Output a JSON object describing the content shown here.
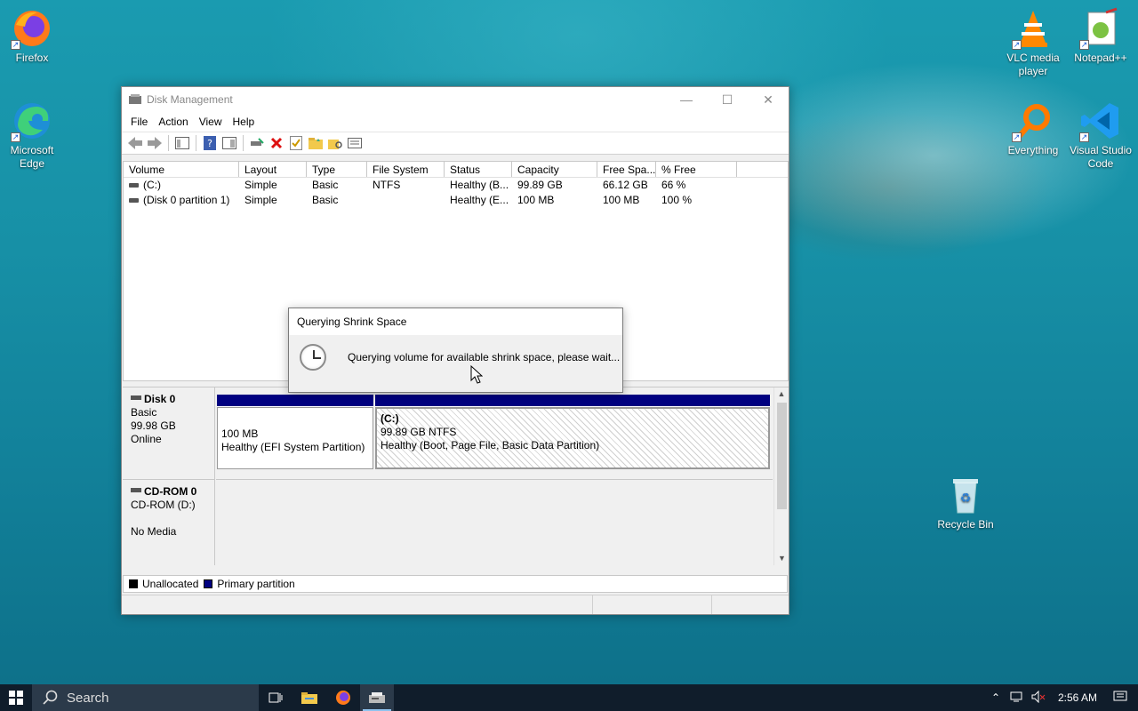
{
  "desktop": {
    "icons": {
      "firefox": "Firefox",
      "edge": "Microsoft Edge",
      "vlc": "VLC media player",
      "notepadpp": "Notepad++",
      "everything": "Everything",
      "vscode": "Visual Studio Code",
      "recycle_bin": "Recycle Bin"
    }
  },
  "window": {
    "title": "Disk Management",
    "menu": [
      "File",
      "Action",
      "View",
      "Help"
    ],
    "columns": [
      "Volume",
      "Layout",
      "Type",
      "File System",
      "Status",
      "Capacity",
      "Free Spa...",
      "% Free"
    ],
    "volumes": [
      {
        "volume": "(C:)",
        "layout": "Simple",
        "type": "Basic",
        "fs": "NTFS",
        "status": "Healthy (B...",
        "capacity": "99.89 GB",
        "free": "66.12 GB",
        "pct": "66 %"
      },
      {
        "volume": "(Disk 0 partition 1)",
        "layout": "Simple",
        "type": "Basic",
        "fs": "",
        "status": "Healthy (E...",
        "capacity": "100 MB",
        "free": "100 MB",
        "pct": "100 %"
      }
    ],
    "disk0": {
      "name": "Disk 0",
      "type": "Basic",
      "size": "99.98 GB",
      "state": "Online",
      "part1": {
        "size": "100 MB",
        "status": "Healthy (EFI System Partition)"
      },
      "part2": {
        "label": "(C:)",
        "size": "99.89 GB NTFS",
        "status": "Healthy (Boot, Page File, Basic Data Partition)"
      }
    },
    "cdrom": {
      "name": "CD-ROM 0",
      "drive": "CD-ROM (D:)",
      "media": "No Media"
    },
    "legend": {
      "unallocated": "Unallocated",
      "primary": "Primary partition",
      "unallocated_color": "#000000",
      "primary_color": "#000080"
    }
  },
  "dialog": {
    "title": "Querying Shrink Space",
    "message": "Querying volume for available shrink space, please wait..."
  },
  "taskbar": {
    "search_placeholder": "Search",
    "time": "2:56 AM"
  }
}
